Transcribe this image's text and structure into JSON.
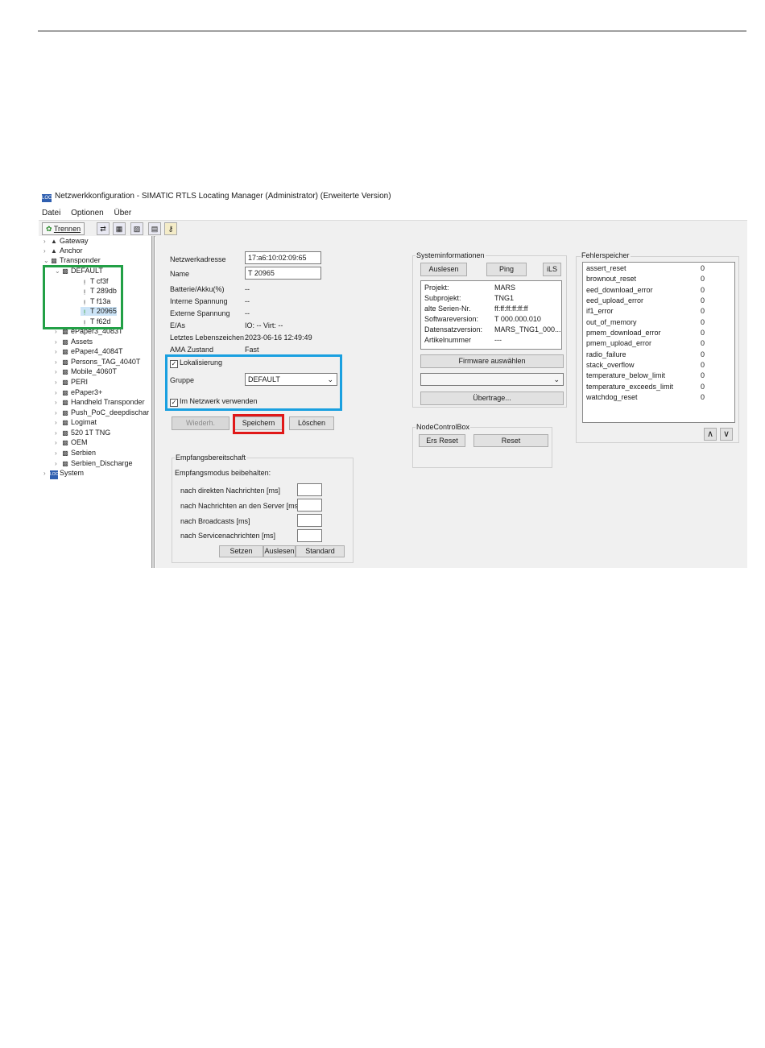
{
  "window": {
    "app_icon": "LOC",
    "title": "Netzwerkkonfiguration - SIMATIC RTLS Locating Manager  (Administrator)  (Erweiterte Version)"
  },
  "menu": [
    "Datei",
    "Optionen",
    "Über"
  ],
  "toolbar": {
    "disconnect_label": "Trennen"
  },
  "tree": {
    "gateway": "Gateway",
    "anchor": "Anchor",
    "transponder": "Transponder",
    "default": "DEFAULT",
    "tags": [
      "T cf3f",
      "T 289db",
      "T f13a",
      "T 20965",
      "T f62d"
    ],
    "groups": [
      "ePaper3_4083T",
      "Assets",
      "ePaper4_4084T",
      "Persons_TAG_4040T",
      "Mobile_4060T",
      "PERI",
      "ePaper3+",
      "Handheld Transponder",
      "Push_PoC_deepdischar",
      "Logimat",
      "520 1T TNG",
      "OEM",
      "Serbien",
      "Serbien_Discharge"
    ],
    "system": "System",
    "system_icon": "LOC"
  },
  "details": {
    "netzwerkadresse_label": "Netzwerkadresse",
    "netzwerkadresse_value": "17:a6:10:02:09:65",
    "name_label": "Name",
    "name_value": "T 20965",
    "batterie_label": "Batterie/Akku(%)",
    "batterie_value": "--",
    "interne_label": "Interne Spannung",
    "interne_value": "--",
    "externe_label": "Externe Spannung",
    "externe_value": "--",
    "eas_label": "E/As",
    "eas_value": "IO: -- Virt: --",
    "lebenszeichen_label": "Letztes Lebenszeichen",
    "lebenszeichen_value": "2023-06-16 12:49:49",
    "ama_label": "AMA Zustand",
    "ama_value": "Fast",
    "lokalisierung_label": "Lokalisierung",
    "gruppe_label": "Gruppe",
    "gruppe_value": "DEFAULT",
    "netzwerk_label": "Im Netzwerk verwenden",
    "btn_wiederh": "Wiederh.",
    "btn_speichern": "Speichern",
    "btn_loeschen": "Löschen"
  },
  "empfang": {
    "title": "Empfangsbereitschaft",
    "subtitle": "Empfangsmodus beibehalten:",
    "rows": [
      "nach direkten Nachrichten [ms]",
      "nach Nachrichten an den Server [ms]",
      "nach Broadcasts [ms]",
      "nach Servicenachrichten [ms]"
    ],
    "btn_setzen": "Setzen",
    "btn_auslesen": "Auslesen",
    "btn_standard": "Standard"
  },
  "sysinfo": {
    "title": "Systeminformationen",
    "btn_auslesen": "Auslesen",
    "btn_ping": "Ping",
    "btn_ils": "iLS",
    "rows": [
      {
        "k": "Projekt:",
        "v": "MARS"
      },
      {
        "k": "Subprojekt:",
        "v": "TNG1"
      },
      {
        "k": "alte Serien-Nr.",
        "v": "ff:ff:ff:ff:ff:ff"
      },
      {
        "k": "Softwareversion:",
        "v": "T 000.000.010"
      },
      {
        "k": "Datensatzversion:",
        "v": "MARS_TNG1_000..."
      },
      {
        "k": "Artikelnummer",
        "v": "---"
      }
    ],
    "btn_firmware": "Firmware auswählen",
    "btn_uebertrage": "Übertrage..."
  },
  "node": {
    "title": "NodeControlBox",
    "btn_ers_reset": "Ers Reset",
    "btn_reset": "Reset"
  },
  "fehler": {
    "title": "Fehlerspeicher",
    "rows": [
      {
        "k": "assert_reset",
        "v": "0"
      },
      {
        "k": "brownout_reset",
        "v": "0"
      },
      {
        "k": "eed_download_error",
        "v": "0"
      },
      {
        "k": "eed_upload_error",
        "v": "0"
      },
      {
        "k": "if1_error",
        "v": "0"
      },
      {
        "k": "out_of_memory",
        "v": "0"
      },
      {
        "k": "pmem_download_error",
        "v": "0"
      },
      {
        "k": "pmem_upload_error",
        "v": "0"
      },
      {
        "k": "radio_failure",
        "v": "0"
      },
      {
        "k": "stack_overflow",
        "v": "0"
      },
      {
        "k": "temperature_below_limit",
        "v": "0"
      },
      {
        "k": "temperature_exceeds_limit",
        "v": "0"
      },
      {
        "k": "watchdog_reset",
        "v": "0"
      }
    ]
  },
  "highlights": {
    "green": "#22a046",
    "blue": "#1aa0e0",
    "red": "#e01818"
  }
}
